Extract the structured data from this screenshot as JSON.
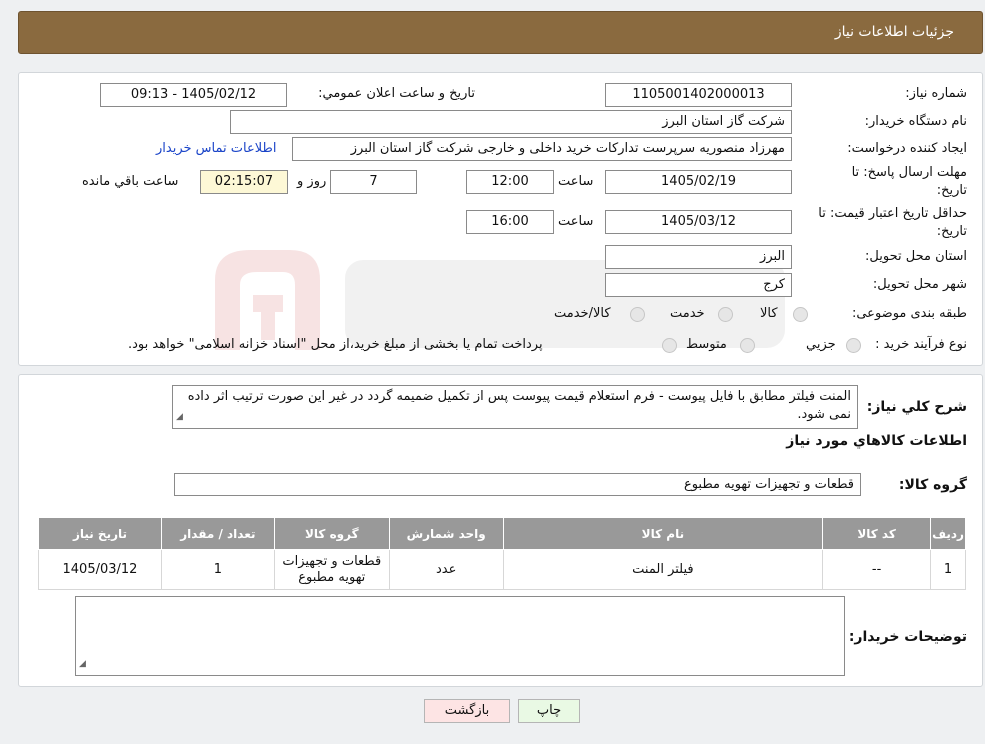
{
  "header": {
    "title": "جزئيات اطلاعات نياز"
  },
  "form": {
    "need_number_label": "شماره نياز:",
    "need_number_value": "1105001402000013",
    "announce_label": "تاريخ و ساعت اعلان عمومي:",
    "announce_value": "1405/02/12 - 09:13",
    "buyer_org_label": "نام دستگاه خريدار:",
    "buyer_org_value": "شرکت گاز استان البرز",
    "creator_label": "ايجاد کننده درخواست:",
    "creator_value": "مهرزاد منصوريه سرپرست تدارکات خريد داخلی و خارجی شرکت گاز استان البرز",
    "contact_link": "اطلاعات تماس خريدار",
    "deadline_label_1": "مهلت ارسال پاسخ: تا",
    "deadline_label_2": "تاريخ:",
    "deadline_date": "1405/02/19",
    "time_label": "ساعت",
    "deadline_time": "12:00",
    "days_value": "7",
    "days_label": "روز و",
    "remaining_value": "02:15:07",
    "remaining_label": "ساعت باقي مانده",
    "validity_label_1": "حداقل تاريخ اعتبار قيمت: تا",
    "validity_label_2": "تاريخ:",
    "validity_date": "1405/03/12",
    "validity_time": "16:00",
    "province_label": "استان محل تحويل:",
    "province_value": "البرز",
    "city_label": "شهر محل تحويل:",
    "city_value": "کرج",
    "category_label": "طبقه بندی موضوعی:",
    "category_options": [
      "کالا",
      "خدمت",
      "کالا/خدمت"
    ],
    "process_label": "نوع فرآيند خريد :",
    "process_options": [
      "جزيي",
      "متوسط"
    ],
    "process_note": "پرداخت تمام يا بخشی از مبلغ خريد،از محل \"اسناد خزانه اسلامی\" خواهد بود."
  },
  "description": {
    "label": "شرح کلي نياز:",
    "text": "المنت فیلتر مطابق با فایل پیوست - فرم استعلام قیمت پیوست پس از تکمیل ضمیمه گردد در غیر این صورت ترتیب اثر داده نمی شود."
  },
  "goods": {
    "section_title": "اطلاعات کالاهاي مورد نياز",
    "group_label": "گروه کالا:",
    "group_value": "قطعات و تجهيزات تهويه مطبوع"
  },
  "table": {
    "headers": [
      "رديف",
      "کد کالا",
      "نام کالا",
      "واحد شمارش",
      "گروه کالا",
      "تعداد / مقدار",
      "تاريخ نياز"
    ],
    "rows": [
      [
        "1",
        "--",
        "فيلتر المنت",
        "عدد",
        "قطعات و تجهيزات تهويه مطبوع",
        "1",
        "1405/03/12"
      ]
    ]
  },
  "buyer_notes": {
    "label": "توضيحات خريدار:",
    "value": ""
  },
  "buttons": {
    "print": "چاپ",
    "back": "بازگشت"
  },
  "colors": {
    "header_bg": "#8a6a3f",
    "table_header_bg": "#999999",
    "print_btn_bg": "#e9f9e4",
    "back_btn_bg": "#fde4e4",
    "link": "#1a44c8"
  }
}
